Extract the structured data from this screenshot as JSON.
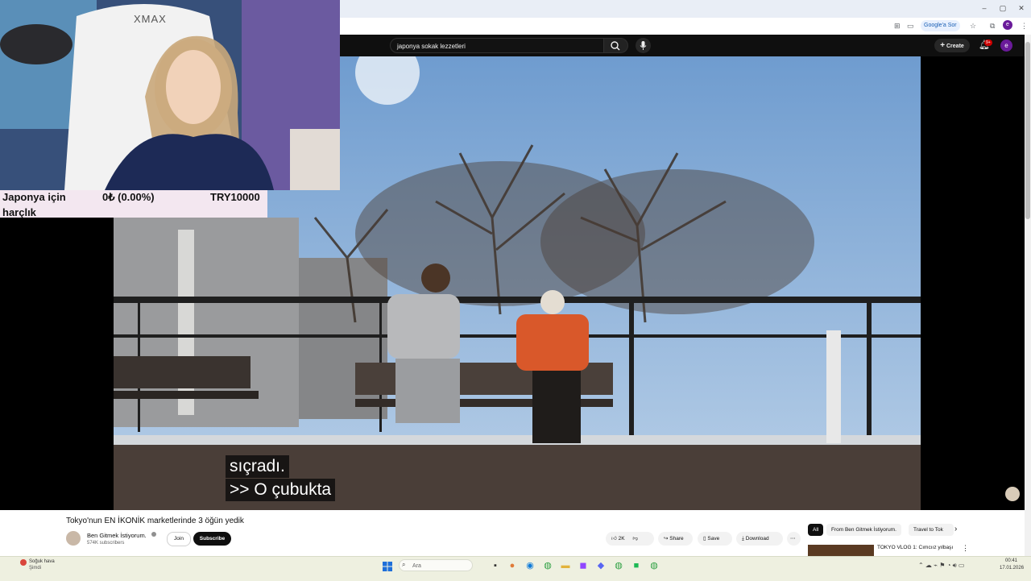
{
  "browser": {
    "window_controls": [
      "–",
      "▢",
      "✕"
    ],
    "toolbar_button": "Google'a Sor"
  },
  "youtube": {
    "search": {
      "value": "japonya sokak lezzetleri"
    },
    "create_label": "Create",
    "notification_badge": "9+",
    "avatar_letter": "e"
  },
  "overlay": {
    "donation_label_line1": "Japonya için",
    "donation_label_line2": "harçlık",
    "donation_progress": "0₺ (0.00%)",
    "donation_goal": "TRY10000",
    "brand_text": "XMAX"
  },
  "subtitles": [
    "sıçradı.",
    ">> O çubukta"
  ],
  "video": {
    "title": "Tokyo'nun EN İKONİK marketlerinde 3 öğün yedik",
    "channel": "Ben Gitmek İstiyorum.",
    "subscribers": "574K subscribers",
    "join_label": "Join",
    "subscribe_label": "Subscribe",
    "likes": "2K",
    "share_label": "Share",
    "save_label": "Save",
    "download_label": "Download"
  },
  "recommendations": {
    "chips": [
      "All",
      "From Ben Gitmek İstiyorum.",
      "Travel to Tok"
    ],
    "first_title": "TOKYO VLOG 1: Cımcıız yılbaşı"
  },
  "taskbar": {
    "weather_line1": "Soğuk hava",
    "weather_line2": "Şimdi",
    "search_placeholder": "Ara",
    "time": "00:41",
    "date": "17.01.2026"
  }
}
